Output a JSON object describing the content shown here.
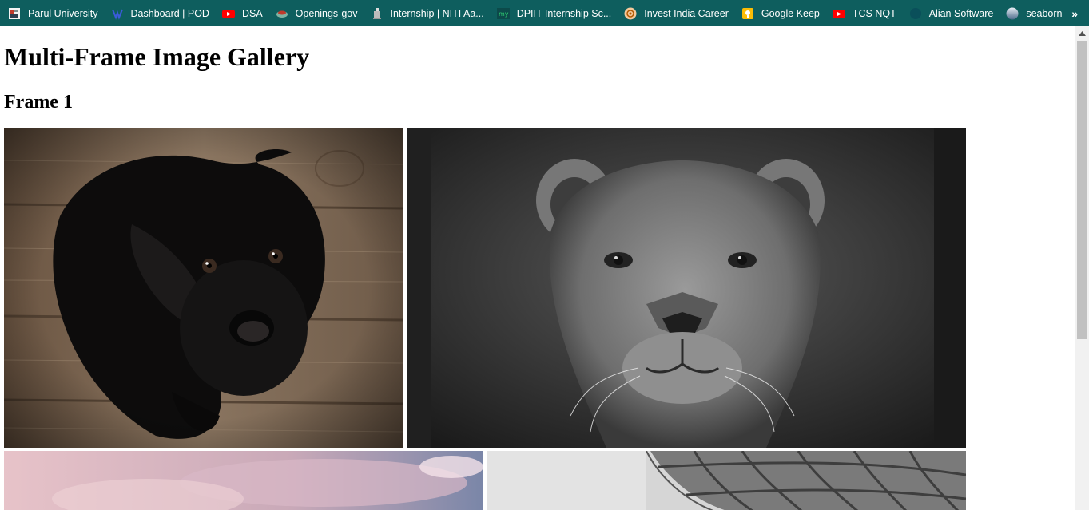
{
  "bookmarks": [
    {
      "label": "Parul University",
      "icon": "parul-university-icon"
    },
    {
      "label": "Dashboard | POD",
      "icon": "pod-icon"
    },
    {
      "label": "DSA",
      "icon": "youtube-icon"
    },
    {
      "label": "Openings-gov",
      "icon": "openings-gov-icon"
    },
    {
      "label": "Internship | NITI Aa...",
      "icon": "niti-aayog-icon"
    },
    {
      "label": "DPIIT Internship Sc...",
      "icon": "mygov-icon"
    },
    {
      "label": "Invest India Career",
      "icon": "invest-india-icon"
    },
    {
      "label": "Google Keep",
      "icon": "google-keep-icon"
    },
    {
      "label": "TCS NQT",
      "icon": "youtube-icon"
    },
    {
      "label": "Alian Software",
      "icon": "alian-software-icon"
    },
    {
      "label": "seaborn",
      "icon": "seaborn-icon"
    }
  ],
  "bookmarks_more": "»",
  "page": {
    "title": "Multi-Frame Image Gallery",
    "frame_heading": "Frame 1",
    "images": [
      {
        "name": "black-puppy-photo"
      },
      {
        "name": "lioness-photo"
      },
      {
        "name": "pink-sky-photo"
      },
      {
        "name": "hot-air-balloon-photo"
      }
    ]
  },
  "colors": {
    "bookmarks_bar": "#0e5e5e",
    "page_background": "#ffffff",
    "text": "#000000"
  }
}
